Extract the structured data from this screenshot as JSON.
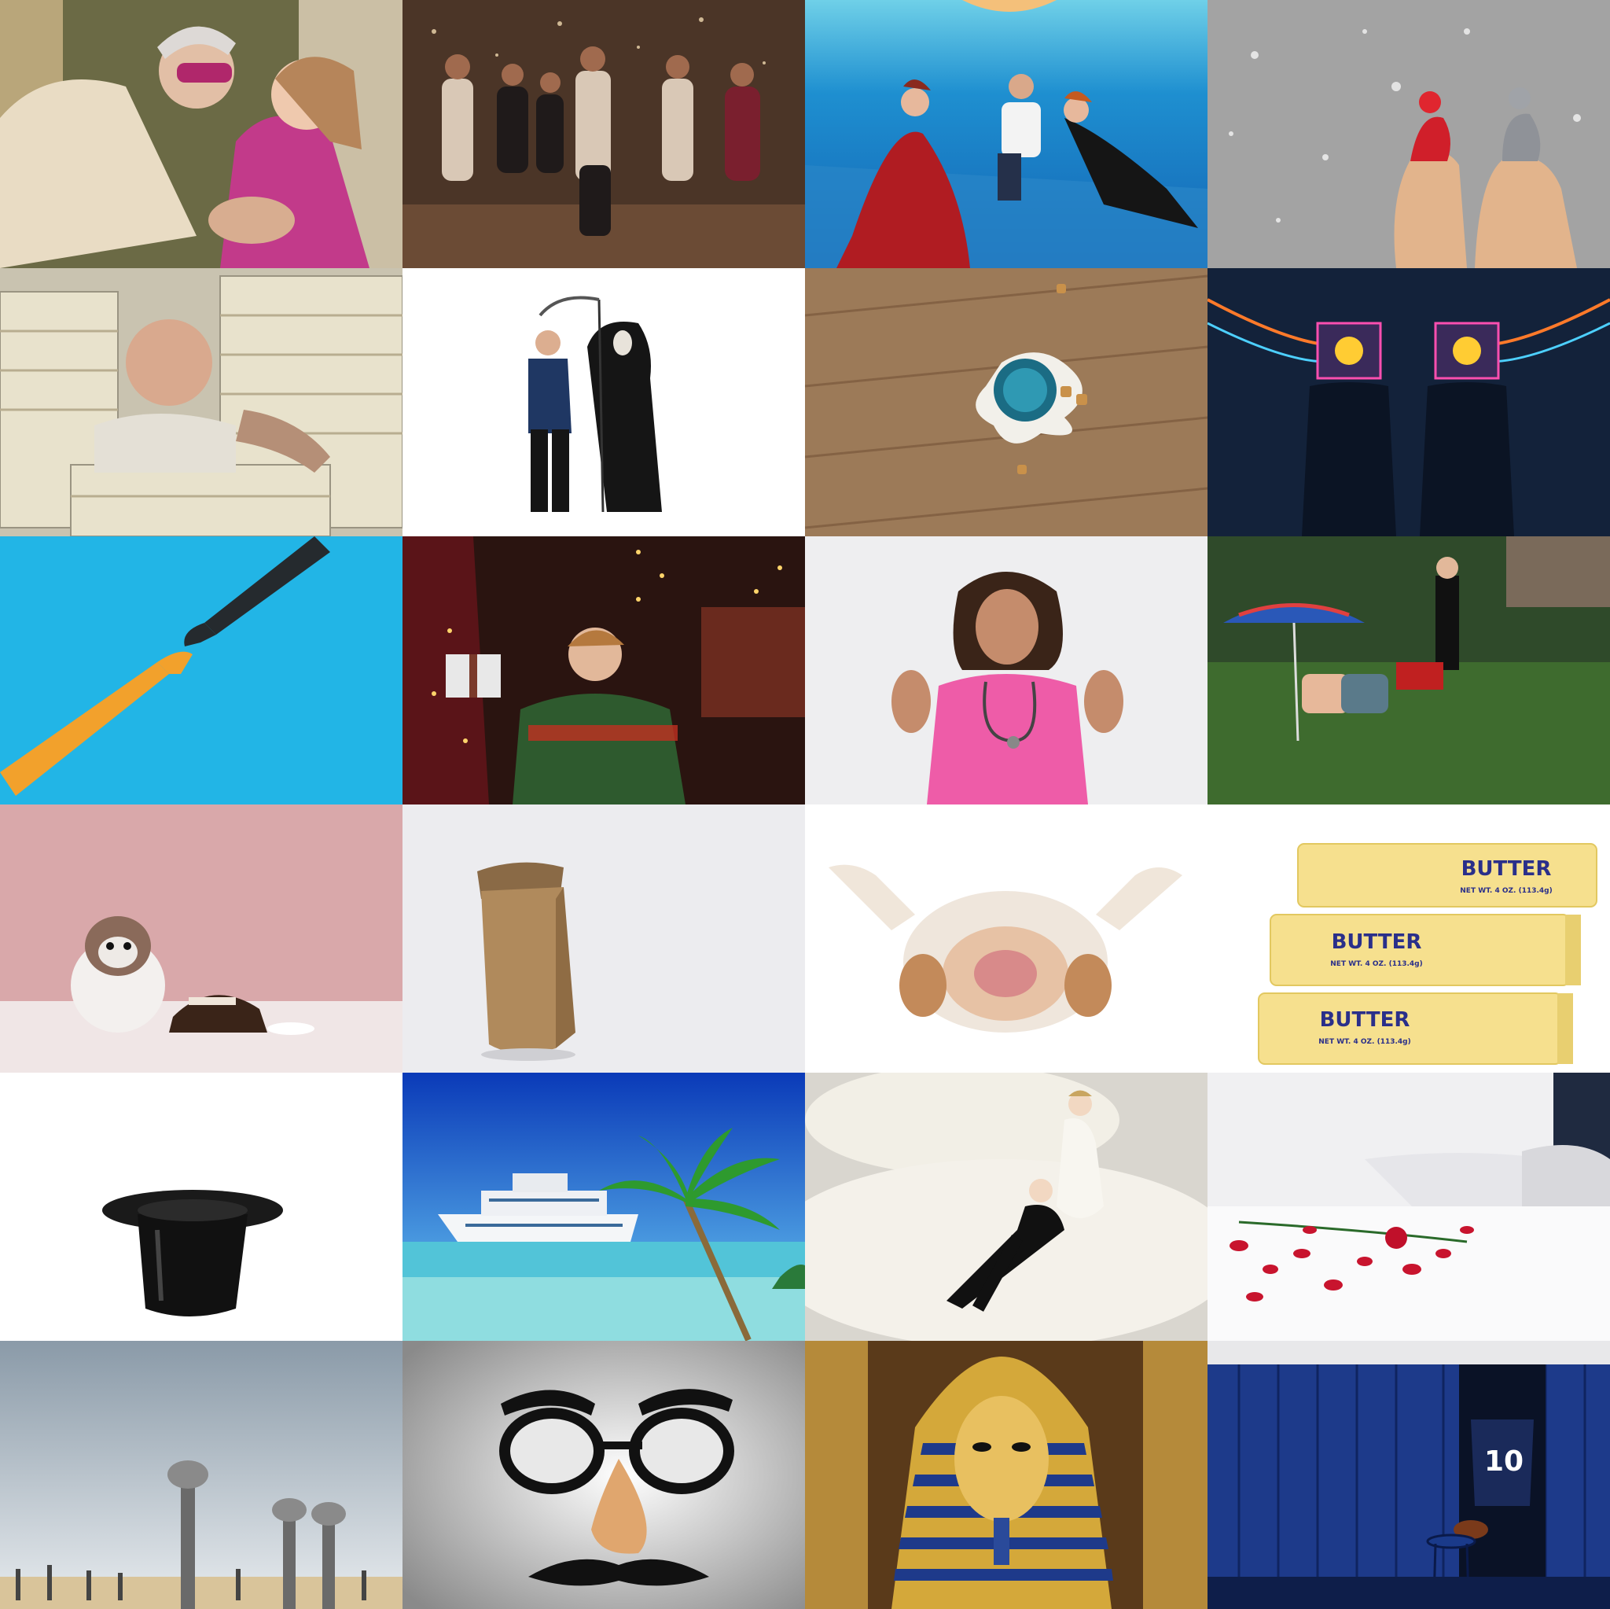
{
  "tiles": [
    {
      "id": 1,
      "subject": "elderly-woman-and-girl"
    },
    {
      "id": 2,
      "subject": "party-dancers-confetti"
    },
    {
      "id": 3,
      "subject": "underwater-tea-party"
    },
    {
      "id": 4,
      "subject": "toes-with-knit-hats"
    },
    {
      "id": 5,
      "subject": "man-buried-in-paperwork"
    },
    {
      "id": 6,
      "subject": "man-and-grim-reaper"
    },
    {
      "id": 7,
      "subject": "spilled-cereal-bowl"
    },
    {
      "id": 8,
      "subject": "figures-with-emoji-screen-heads"
    },
    {
      "id": 9,
      "subject": "robot-and-doll-hands"
    },
    {
      "id": 10,
      "subject": "boy-with-christmas-gift"
    },
    {
      "id": 11,
      "subject": "nurse-rock-gesture"
    },
    {
      "id": 12,
      "subject": "butler-mowing-lawn"
    },
    {
      "id": 13,
      "subject": "puppy-and-cake"
    },
    {
      "id": 14,
      "subject": "paper-bag"
    },
    {
      "id": 15,
      "subject": "upside-down-bulldog"
    },
    {
      "id": 16,
      "subject": "butter-sticks"
    },
    {
      "id": 17,
      "subject": "top-hat"
    },
    {
      "id": 18,
      "subject": "cruise-ship-and-palm"
    },
    {
      "id": 19,
      "subject": "wedding-cake-topper"
    },
    {
      "id": 20,
      "subject": "rose-petals-on-bed"
    },
    {
      "id": 21,
      "subject": "ostriches"
    },
    {
      "id": 22,
      "subject": "groucho-glasses"
    },
    {
      "id": 23,
      "subject": "pharaoh-mask"
    },
    {
      "id": 24,
      "subject": "locker-room-jersey"
    }
  ],
  "butter": {
    "label": "BUTTER",
    "weight": "NET WT. 4 OZ. (113.4g)"
  },
  "jersey_number": "10",
  "colors": {
    "pool_blue": "#1e8fd0",
    "background_cyan": "#22b5e6",
    "nurse_pink": "#ee5ca8",
    "locker_blue": "#1d3a8a",
    "butter_yellow": "#f6e08e"
  }
}
